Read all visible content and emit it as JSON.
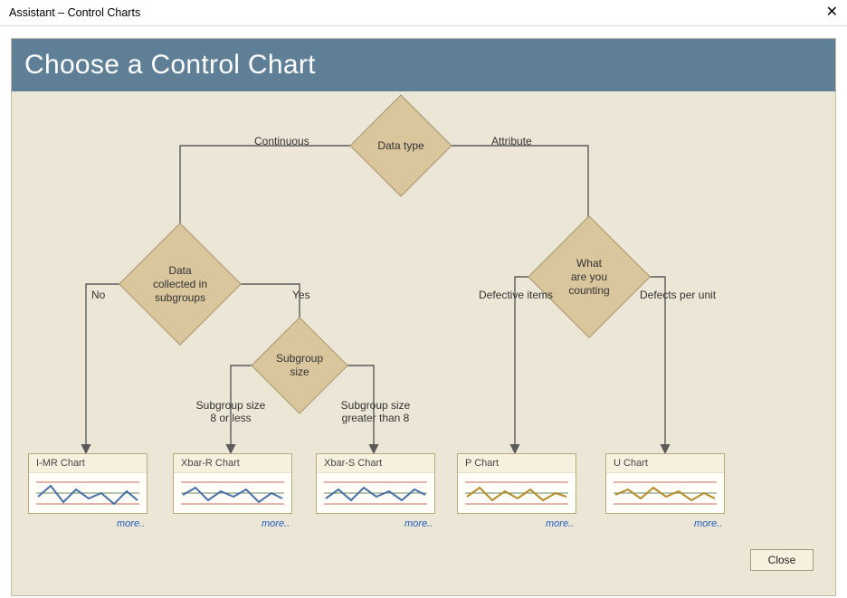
{
  "window": {
    "title": "Assistant – Control Charts"
  },
  "header": {
    "title": "Choose a Control Chart"
  },
  "decision": {
    "dataType": {
      "label": "Data type",
      "left": "Continuous",
      "right": "Attribute"
    },
    "subgroups": {
      "label": "Data\ncollected in\nsubgroups",
      "left": "No",
      "right": "Yes"
    },
    "subgroupSize": {
      "label": "Subgroup\nsize",
      "left": "Subgroup size\n8 or less",
      "right": "Subgroup size\ngreater than 8"
    },
    "counting": {
      "label": "What\nare you\ncounting",
      "left": "Defective items",
      "right": "Defects per unit"
    }
  },
  "cards": {
    "imr": {
      "title": "I-MR Chart",
      "more": "more..",
      "series_color": "#4a6fa5"
    },
    "xbarr": {
      "title": "Xbar-R Chart",
      "more": "more..",
      "series_color": "#4a6fa5"
    },
    "xbars": {
      "title": "Xbar-S Chart",
      "more": "more..",
      "series_color": "#4a6fa5"
    },
    "p": {
      "title": "P Chart",
      "more": "more..",
      "series_color": "#b58b2b"
    },
    "u": {
      "title": "U Chart",
      "more": "more..",
      "series_color": "#b58b2b"
    }
  },
  "footer": {
    "close": "Close"
  },
  "chart_data": {
    "type": "diagram",
    "description": "Decision tree for choosing a control chart",
    "nodes": [
      {
        "id": "data_type",
        "kind": "decision",
        "label": "Data type"
      },
      {
        "id": "subgroups",
        "kind": "decision",
        "label": "Data collected in subgroups"
      },
      {
        "id": "subgroup_size",
        "kind": "decision",
        "label": "Subgroup size"
      },
      {
        "id": "counting",
        "kind": "decision",
        "label": "What are you counting"
      },
      {
        "id": "imr",
        "kind": "leaf",
        "label": "I-MR Chart"
      },
      {
        "id": "xbarr",
        "kind": "leaf",
        "label": "Xbar-R Chart"
      },
      {
        "id": "xbars",
        "kind": "leaf",
        "label": "Xbar-S Chart"
      },
      {
        "id": "p",
        "kind": "leaf",
        "label": "P Chart"
      },
      {
        "id": "u",
        "kind": "leaf",
        "label": "U Chart"
      }
    ],
    "edges": [
      {
        "from": "data_type",
        "to": "subgroups",
        "label": "Continuous"
      },
      {
        "from": "data_type",
        "to": "counting",
        "label": "Attribute"
      },
      {
        "from": "subgroups",
        "to": "imr",
        "label": "No"
      },
      {
        "from": "subgroups",
        "to": "subgroup_size",
        "label": "Yes"
      },
      {
        "from": "subgroup_size",
        "to": "xbarr",
        "label": "Subgroup size 8 or less"
      },
      {
        "from": "subgroup_size",
        "to": "xbars",
        "label": "Subgroup size greater than 8"
      },
      {
        "from": "counting",
        "to": "p",
        "label": "Defective items"
      },
      {
        "from": "counting",
        "to": "u",
        "label": "Defects per unit"
      }
    ]
  }
}
